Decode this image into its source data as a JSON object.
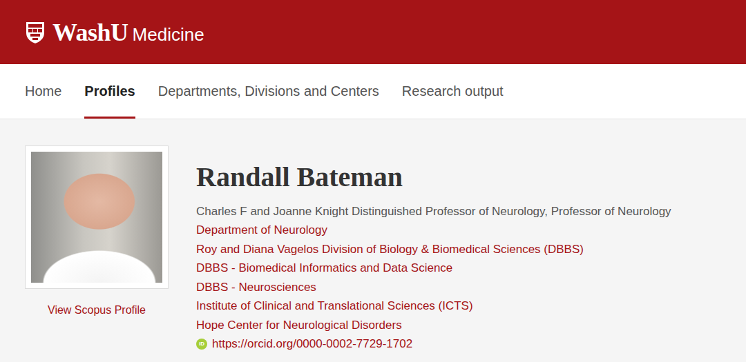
{
  "header": {
    "logo": {
      "brand": "WashU",
      "sub": "Medicine"
    }
  },
  "nav": [
    {
      "label": "Home",
      "selected": false
    },
    {
      "label": "Profiles",
      "selected": true
    },
    {
      "label": "Departments, Divisions and Centers",
      "selected": false
    },
    {
      "label": "Research output",
      "selected": false
    }
  ],
  "profile": {
    "name": "Randall Bateman",
    "title": "Charles F and Joanne Knight Distinguished Professor of Neurology, Professor of Neurology",
    "affiliations": [
      "Department of Neurology",
      "Roy and Diana Vagelos Division of Biology & Biomedical Sciences (DBBS)",
      "DBBS - Biomedical Informatics and Data Science",
      "DBBS - Neurosciences",
      "Institute of Clinical and Translational Sciences (ICTS)",
      "Hope Center for Neurological Disorders"
    ],
    "orcid": {
      "badge": "iD",
      "url": "https://orcid.org/0000-0002-7729-1702"
    },
    "scopus_link": "View Scopus Profile"
  }
}
